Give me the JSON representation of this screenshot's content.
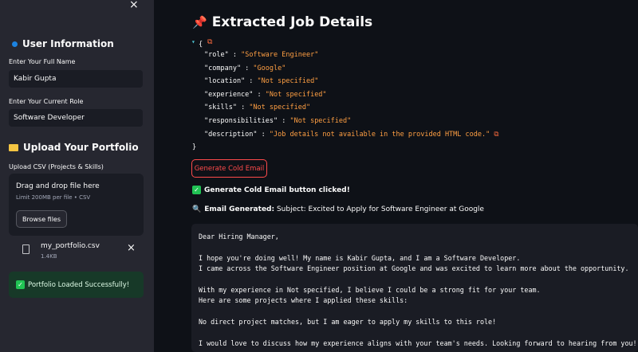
{
  "sidebar": {
    "close_icon": "×",
    "user_info_heading": "User Information",
    "name_label": "Enter Your Full Name",
    "name_value": "Kabir Gupta",
    "role_label": "Enter Your Current Role",
    "role_value": "Software Developer",
    "upload_heading": "Upload Your Portfolio",
    "upload_label": "Upload CSV (Projects & Skills)",
    "dropzone_title": "Drag and drop file here",
    "dropzone_limit": "Limit 200MB per file • CSV",
    "browse_label": "Browse files",
    "file_name": "my_portfolio.csv",
    "file_size": "1.4KB",
    "remove_icon": "×",
    "success_message": "Portfolio Loaded Successfully!"
  },
  "main": {
    "title": "Extracted Job Details",
    "json": {
      "open_brace": "{",
      "close_brace": "}",
      "entries": [
        {
          "key": "\"role\"",
          "value": "\"Software Engineer\""
        },
        {
          "key": "\"company\"",
          "value": "\"Google\""
        },
        {
          "key": "\"location\"",
          "value": "\"Not specified\""
        },
        {
          "key": "\"experience\"",
          "value": "\"Not specified\""
        },
        {
          "key": "\"skills\"",
          "value": "\"Not specified\""
        },
        {
          "key": "\"responsibilities\"",
          "value": "\"Not specified\""
        },
        {
          "key": "\"description\"",
          "value": "\"Job details not available in the provided HTML code.\""
        }
      ]
    },
    "generate_button": "Generate Cold Email",
    "clicked_message": "Generate Cold Email button clicked!",
    "email_generated_label": "Email Generated:",
    "email_subject": "Subject: Excited to Apply for Software Engineer at Google",
    "email_body": "Dear Hiring Manager,\n\nI hope you're doing well! My name is Kabir Gupta, and I am a Software Developer.\nI came across the Software Engineer position at Google and was excited to learn more about the opportunity.\n\nWith my experience in Not specified, I believe I could be a strong fit for your team.\nHere are some projects where I applied these skills:\n\nNo direct project matches, but I am eager to apply my skills to this role!\n\nI would love to discuss how my experience aligns with your team's needs. Looking forward to hearing from you!"
  },
  "colors": {
    "sidebar_bg": "#262730",
    "main_bg": "#0e1117",
    "accent_red": "#ff4b4b",
    "json_value": "#ff9f43",
    "success_bg": "#173928"
  }
}
